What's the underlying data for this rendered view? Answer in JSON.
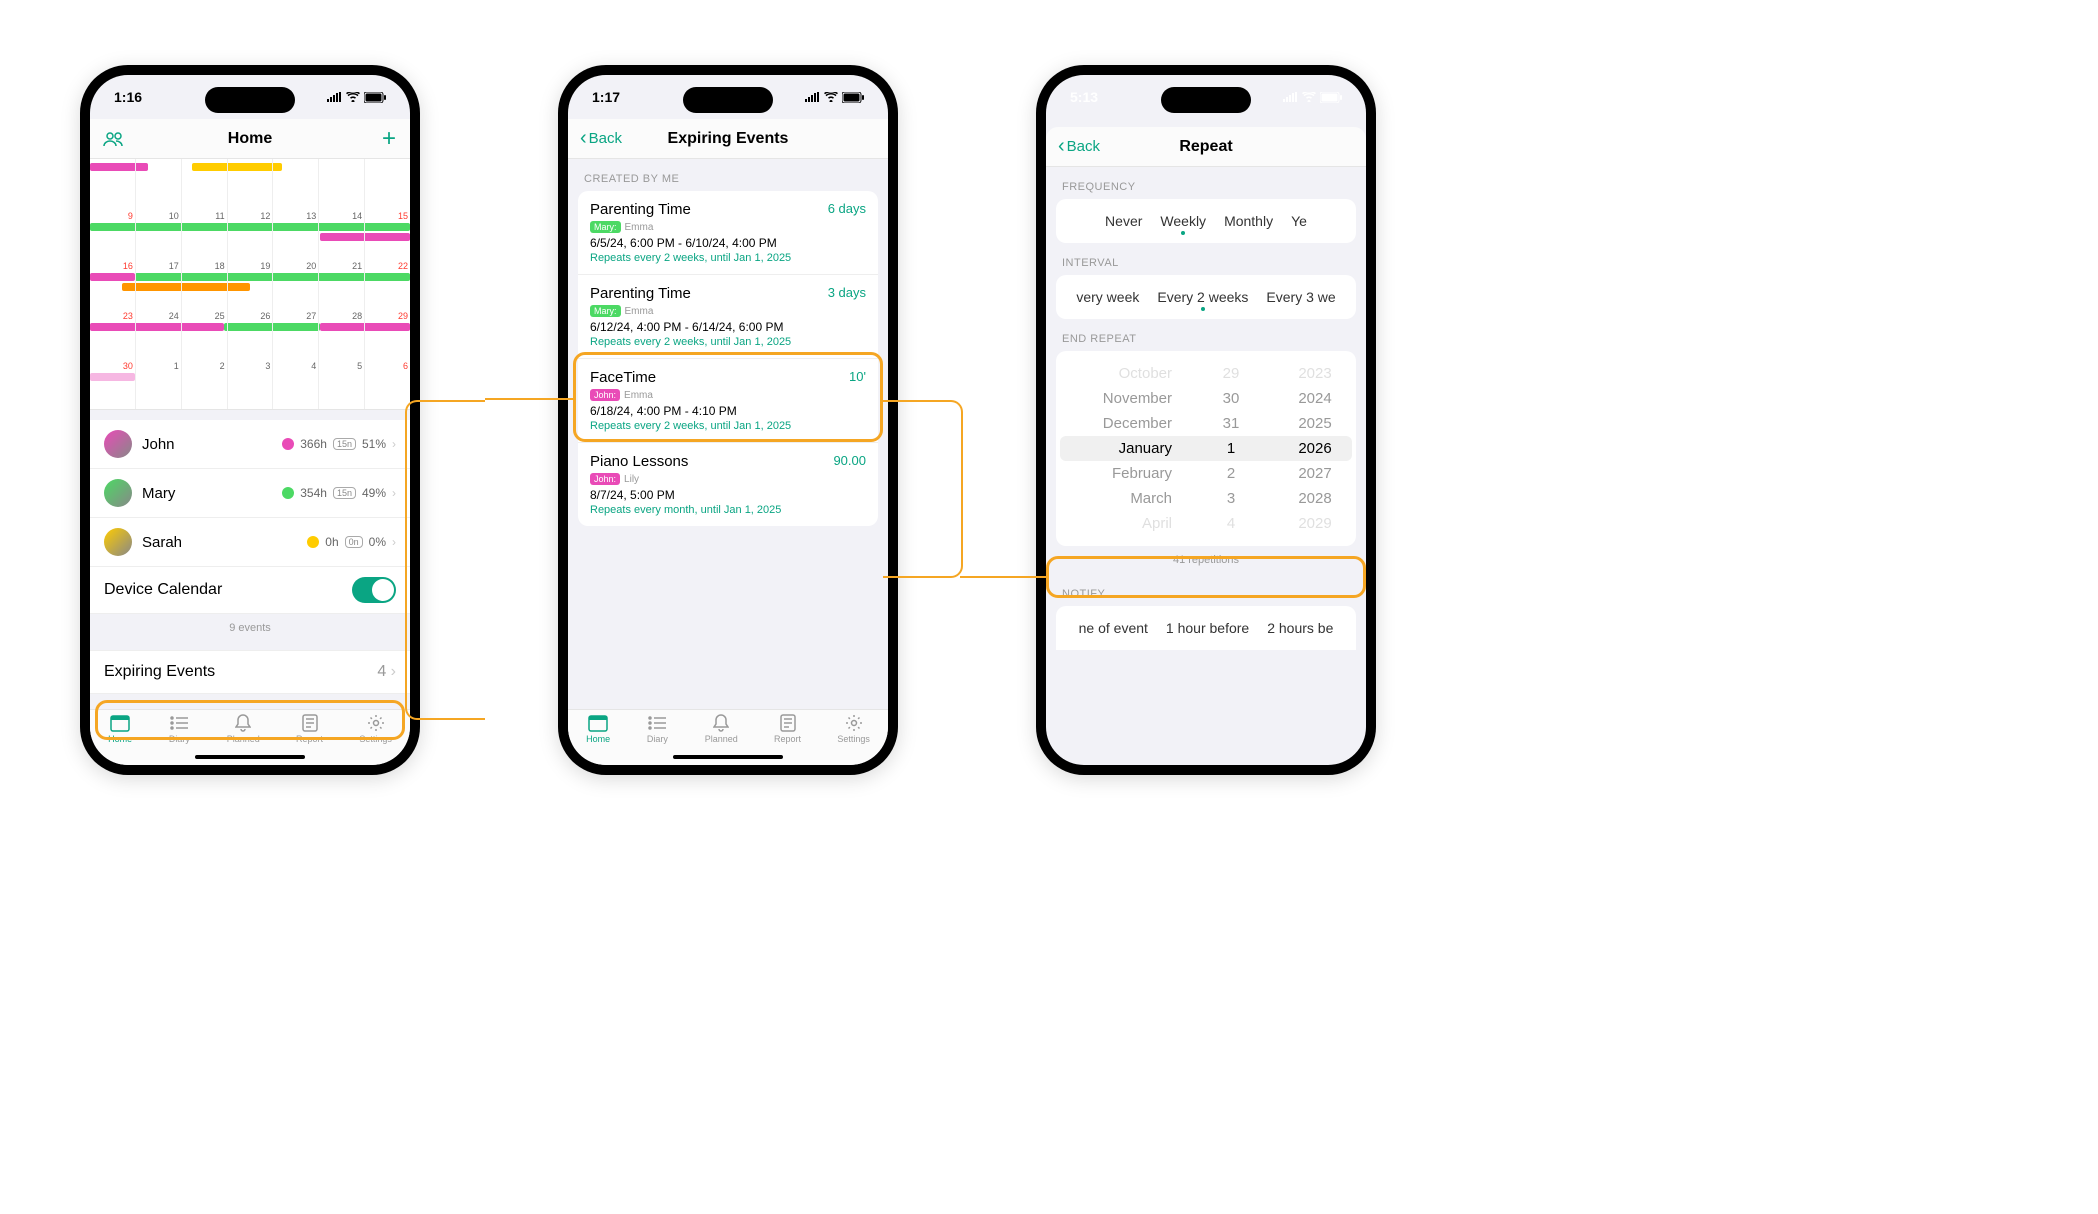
{
  "phone1": {
    "time": "1:16",
    "title": "Home",
    "cal": {
      "rows": [
        {
          "days": [
            "",
            "",
            "",
            "",
            "",
            "",
            ""
          ]
        },
        {
          "days": [
            "9",
            "10",
            "11",
            "12",
            "13",
            "14",
            "15"
          ]
        },
        {
          "days": [
            "16",
            "17",
            "18",
            "19",
            "20",
            "21",
            "22"
          ]
        },
        {
          "days": [
            "23",
            "24",
            "25",
            "26",
            "27",
            "28",
            "29"
          ]
        },
        {
          "days": [
            "30",
            "1",
            "2",
            "3",
            "4",
            "5",
            "6"
          ]
        }
      ]
    },
    "people": [
      {
        "name": "John",
        "hours": "366h",
        "badge": "15n",
        "pct": "51%",
        "color": "#e94bb7"
      },
      {
        "name": "Mary",
        "hours": "354h",
        "badge": "15n",
        "pct": "49%",
        "color": "#4cd964"
      },
      {
        "name": "Sarah",
        "hours": "0h",
        "badge": "0n",
        "pct": "0%",
        "color": "#ffcc00"
      }
    ],
    "device_calendar": "Device Calendar",
    "events_count": "9 events",
    "expiring": {
      "label": "Expiring Events",
      "count": "4"
    }
  },
  "phone2": {
    "time": "1:17",
    "back": "Back",
    "title": "Expiring Events",
    "section": "CREATED BY ME",
    "events": [
      {
        "title": "Parenting Time",
        "days": "6 days",
        "tag": "Mary:",
        "tag_class": "mary",
        "after": "Emma",
        "time": "6/5/24, 6:00 PM - 6/10/24, 4:00 PM",
        "repeat": "Repeats every 2 weeks, until Jan 1, 2025"
      },
      {
        "title": "Parenting Time",
        "days": "3 days",
        "tag": "Mary:",
        "tag_class": "mary",
        "after": "Emma",
        "time": "6/12/24, 4:00 PM - 6/14/24, 6:00 PM",
        "repeat": "Repeats every 2 weeks, until Jan 1, 2025"
      },
      {
        "title": "FaceTime",
        "days": "10'",
        "tag": "John:",
        "tag_class": "john",
        "after": "Emma",
        "time": "6/18/24, 4:00 PM - 4:10 PM",
        "repeat": "Repeats every 2 weeks, until Jan 1, 2025"
      },
      {
        "title": "Piano Lessons",
        "days": "90.00",
        "tag": "John:",
        "tag_class": "john",
        "after": "Lily",
        "time": "8/7/24, 5:00 PM",
        "repeat": "Repeats every month, until Jan 1, 2025"
      }
    ]
  },
  "phone3": {
    "time": "5:13",
    "back": "Back",
    "title": "Repeat",
    "freq": {
      "label": "FREQUENCY",
      "items": [
        "Never",
        "Weekly",
        "Monthly",
        "Ye"
      ],
      "sel": 1
    },
    "interval": {
      "label": "INTERVAL",
      "items": [
        "very week",
        "Every 2 weeks",
        "Every 3 we"
      ],
      "sel": 1
    },
    "end": {
      "label": "END REPEAT",
      "rows": [
        {
          "m": "October",
          "d": "29",
          "y": "2023",
          "fade": true
        },
        {
          "m": "November",
          "d": "30",
          "y": "2024"
        },
        {
          "m": "December",
          "d": "31",
          "y": "2025"
        },
        {
          "m": "January",
          "d": "1",
          "y": "2026",
          "sel": true
        },
        {
          "m": "February",
          "d": "2",
          "y": "2027"
        },
        {
          "m": "March",
          "d": "3",
          "y": "2028"
        },
        {
          "m": "April",
          "d": "4",
          "y": "2029",
          "fade": true
        }
      ]
    },
    "rep_count": "41 repetitions",
    "notify": {
      "label": "NOTIFY",
      "items": [
        "ne of event",
        "1 hour before",
        "2 hours be"
      ]
    }
  },
  "tabs": [
    {
      "name": "Home",
      "icon": "calendar"
    },
    {
      "name": "Diary",
      "icon": "list"
    },
    {
      "name": "Planned",
      "icon": "bell"
    },
    {
      "name": "Report",
      "icon": "doc"
    },
    {
      "name": "Settings",
      "icon": "gear"
    }
  ]
}
